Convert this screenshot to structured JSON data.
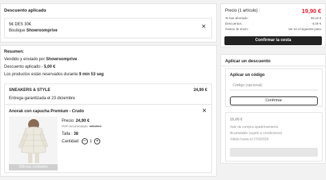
{
  "discount_applied": {
    "heading": "Descuento aplicado",
    "code": "5€ DES 30€",
    "source_prefix": "Boutique ",
    "source_brand": "Showroomprive",
    "close_icon": "×"
  },
  "summary": {
    "heading": "Resumen:",
    "sold_by_prefix": "Vendido y enviado por ",
    "sold_by_brand": "Showroomprive",
    "discount_prefix": "Descuento aplicado - ",
    "discount_value": "5,00 €",
    "reserved_prefix": "Los productos están reservados durante ",
    "reserved_time": "9 min 53 seg",
    "shipment": {
      "title": "SNEAKERS & STYLE",
      "total": "24,90 €",
      "delivery": "Entrega garantizada el 23 diciembre"
    },
    "product": {
      "name": "Anorak con capucha Premium - Crudo",
      "price_label": "Precio: ",
      "price": "24,90 €",
      "rrp_label": "PVP recomendado: ",
      "rrp": "499,00 €",
      "size_label": "Talla : ",
      "size": "38",
      "qty_label": "Cantidad:",
      "qty": "1",
      "minus": "−",
      "plus": "+",
      "badge": "Últimas unidades"
    }
  },
  "totals": {
    "price_label": "Precio (1 artículo) :",
    "price_value": "19,90 €",
    "saved_label": "Te has ahorrado:",
    "saved_value": "80,10 €",
    "discounts_label": "Descuentos:",
    "discounts_value": "-5,00 €",
    "shipping_label": "Gastos de envío:",
    "shipping_value": "Ver en el siguiente paso",
    "confirm_button": "Confirmar la cesta"
  },
  "apply_discount": {
    "heading": "Aplicar un descuento",
    "code_heading": "Aplicar un código",
    "code_placeholder": "Código (opcional)",
    "confirm_button": "Confirmar",
    "voucher_value": "15,00 €",
    "voucher_line1": "Vale de compra apadrinamiento",
    "voucher_line2": "Acumulable (sujeto a condiciones)",
    "voucher_line3": "Válido hasta el 27/3/2026"
  },
  "colors": {
    "price_red": "#e3172c",
    "dark": "#222222",
    "background": "#f2f2f2"
  }
}
